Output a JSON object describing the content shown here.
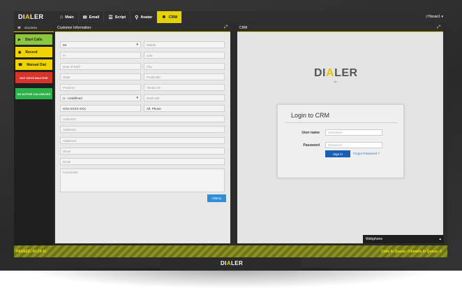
{
  "app": {
    "logo_prefix": "DI",
    "logo_a": "A",
    "logo_suffix": "LER"
  },
  "nav": {
    "items": [
      {
        "label": "Main",
        "icon": "home-icon",
        "glyph": "⌂"
      },
      {
        "label": "Email",
        "icon": "envelope-icon",
        "glyph": "✉"
      },
      {
        "label": "Script",
        "icon": "document-icon",
        "glyph": "☰"
      },
      {
        "label": "Avatar",
        "icon": "avatar-icon",
        "glyph": "⚲"
      },
      {
        "label": "CRM",
        "icon": "people-icon",
        "glyph": "☻"
      }
    ],
    "user": "Hissan1"
  },
  "rail": {
    "campaign_id": "02122016",
    "start_calls": "Start Calls",
    "record": "Record",
    "manual_dial": "Manual Dial",
    "hot_keys": "HOT KEYS INACTIVE",
    "no_active_callbacks": "NO ACTIVE CALLBACKS"
  },
  "customer": {
    "title": "Customer Information:",
    "title_select": "Mr",
    "middle": "Middle",
    "first": "FI",
    "last": "Last",
    "dob": "Date of Birth",
    "city": "City",
    "state": "State",
    "postcode": "PostCode",
    "province": "Province",
    "vendor_id": "Vendor ID",
    "gmt": "U - Undefined",
    "dial_code": "DialCode",
    "phone": "XXX-XXXX-XXX",
    "alt_phone": "Alt. Phone",
    "address1": "Address1",
    "address2": "Address2",
    "address3": "Address3",
    "show": "Show",
    "email": "Email",
    "comments": "Comments",
    "history_button": "History"
  },
  "crm": {
    "panel_title": "CRM",
    "login_title": "Login to CRM",
    "username_label": "User name",
    "username_placeholder": "Username",
    "password_label": "Password",
    "password_placeholder": "Password",
    "signin_button": "Sign in",
    "forgot_password": "Forgot Password ?",
    "logo_sub": "360"
  },
  "webphone": {
    "label": "Webphone"
  },
  "status": {
    "paused": "PAUSED: 00:23:41",
    "queues": "Calls In Queue: 0 Emails In Queue: 0"
  }
}
